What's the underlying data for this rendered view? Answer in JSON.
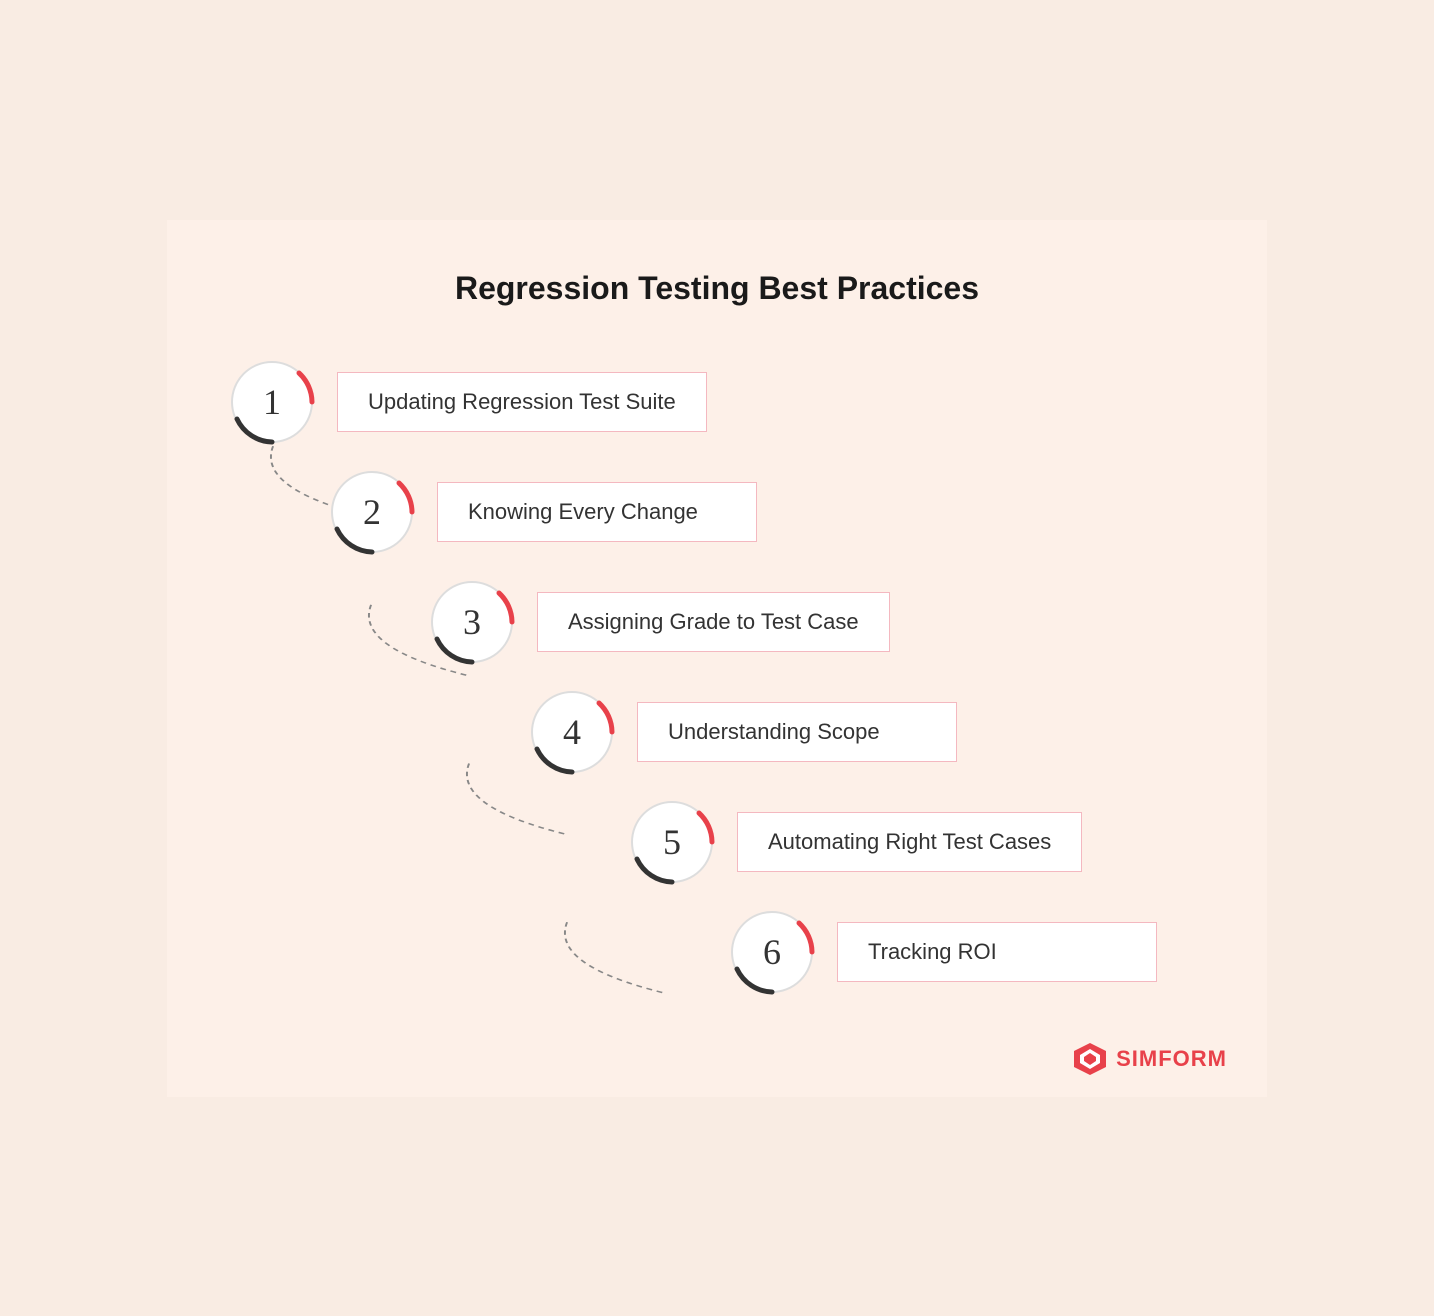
{
  "title": "Regression Testing Best Practices",
  "steps": [
    {
      "number": "1",
      "label": "Updating Regression Test Suite"
    },
    {
      "number": "2",
      "label": "Knowing Every Change"
    },
    {
      "number": "3",
      "label": "Assigning Grade to Test Case"
    },
    {
      "number": "4",
      "label": "Understanding Scope"
    },
    {
      "number": "5",
      "label": "Automating Right Test Cases"
    },
    {
      "number": "6",
      "label": "Tracking ROI"
    }
  ],
  "logo": {
    "text": "SIMFORM",
    "brand_color": "#e8414a"
  },
  "colors": {
    "background": "#fdf0e8",
    "circle_stroke_dark": "#333333",
    "circle_stroke_red": "#e8414a",
    "box_border": "#f4b8c0",
    "connector_dash": "#888888"
  }
}
